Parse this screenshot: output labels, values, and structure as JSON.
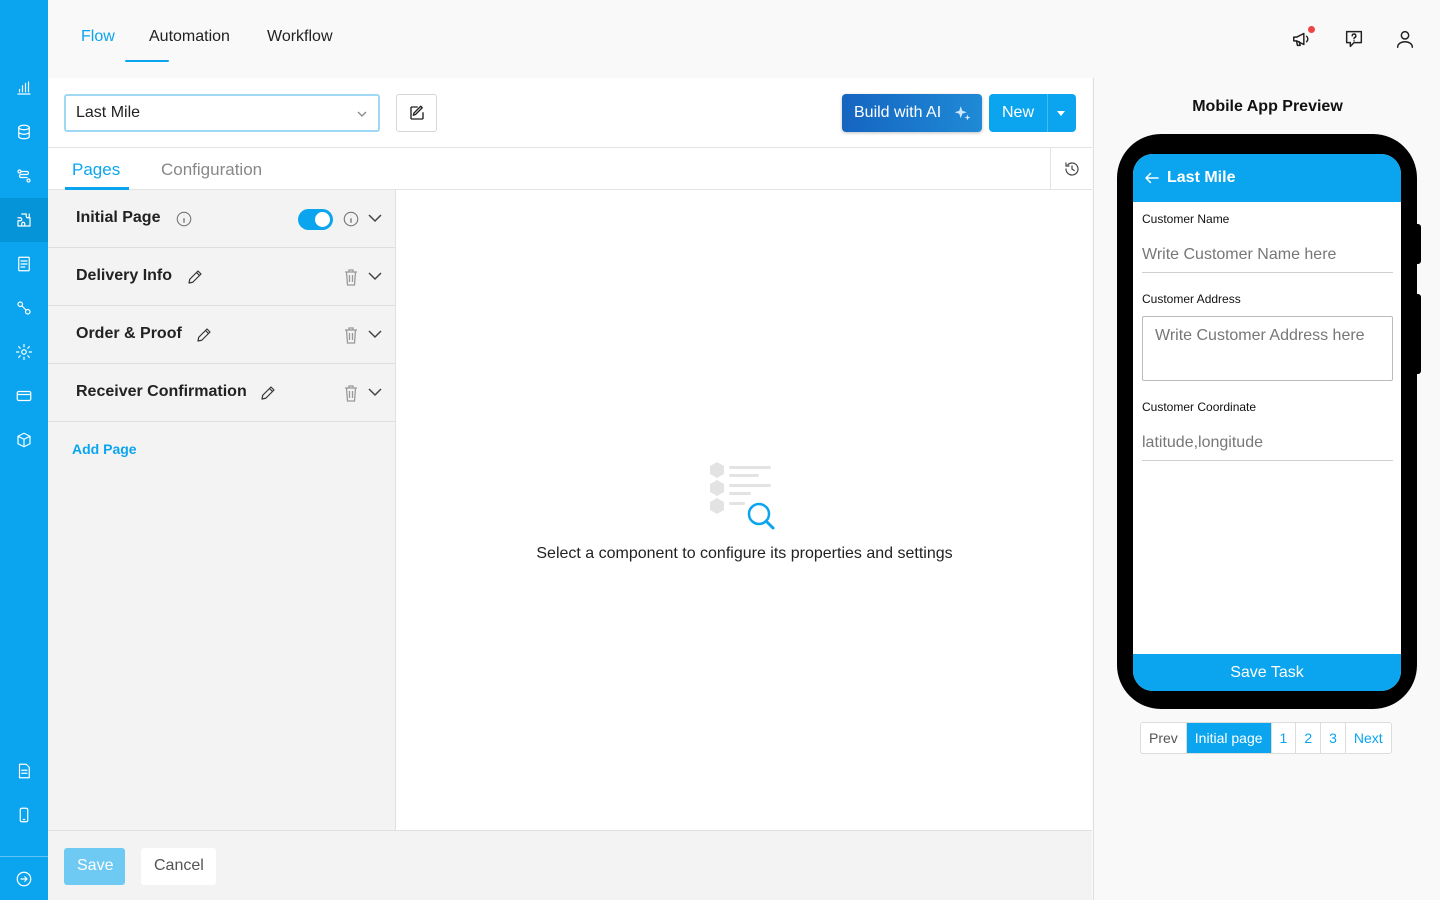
{
  "nav": {
    "tabs": [
      {
        "label": "Flow",
        "active": true
      },
      {
        "label": "Automation",
        "active": false
      },
      {
        "label": "Workflow",
        "active": false
      }
    ],
    "icons": [
      "megaphone-icon",
      "help-chat-icon",
      "user-icon"
    ],
    "has_notification": true
  },
  "sidebar": {
    "icons": [
      "analytics-icon",
      "database-icon",
      "flow-icon",
      "plugin-icon",
      "report-icon",
      "integration-icon",
      "settings-icon",
      "billing-icon",
      "package-icon",
      "document-icon",
      "mobile-icon",
      "logout-icon"
    ],
    "active_index": 3
  },
  "toolbar": {
    "flow_select_value": "Last Mile",
    "build_ai_label": "Build with AI",
    "new_label": "New"
  },
  "subtabs": [
    {
      "label": "Pages",
      "active": true
    },
    {
      "label": "Configuration",
      "active": false
    }
  ],
  "pages": [
    {
      "name": "Initial Page",
      "enabled": true
    },
    {
      "name": "Delivery Info"
    },
    {
      "name": "Order & Proof"
    },
    {
      "name": "Receiver Confirmation"
    }
  ],
  "add_page_label": "Add Page",
  "canvas": {
    "empty_message": "Select a component to configure its properties and settings"
  },
  "footer": {
    "save_label": "Save",
    "cancel_label": "Cancel"
  },
  "preview": {
    "title": "Mobile App Preview",
    "app_title": "Last Mile",
    "fields": [
      {
        "label": "Customer Name",
        "placeholder": "Write Customer Name here"
      },
      {
        "label": "Customer Address",
        "placeholder": "Write Customer Address here"
      },
      {
        "label": "Customer Coordinate",
        "placeholder": "latitude,longitude"
      }
    ],
    "submit_label": "Save Task",
    "pager": [
      "Prev",
      "Initial page",
      "1",
      "2",
      "3",
      "Next"
    ],
    "pager_active": "Initial page"
  },
  "colors": {
    "accent": "#0aa5ee",
    "ai_gradient_start": "#1565c0",
    "notification": "#ef4444"
  }
}
